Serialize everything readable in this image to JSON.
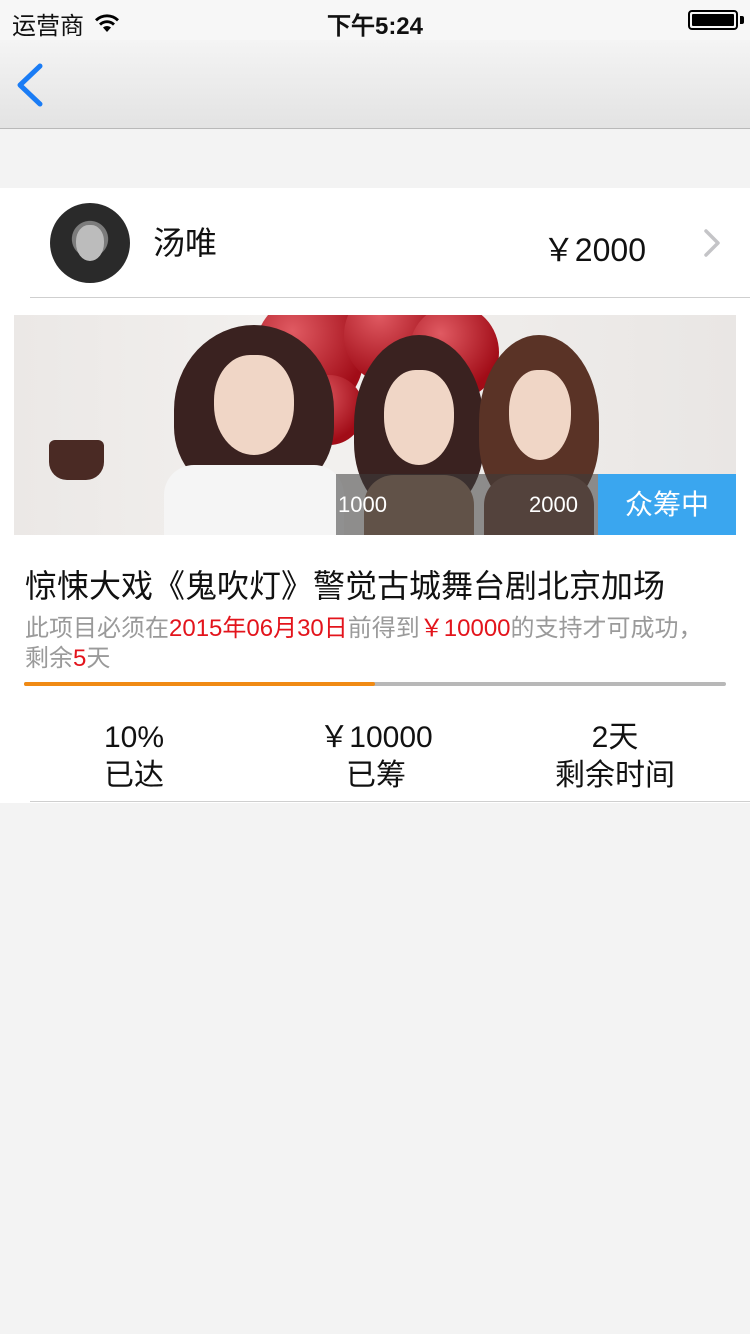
{
  "status_bar": {
    "carrier": "运营商",
    "time": "下午5:24",
    "wifi_icon": "wifi-icon",
    "battery_icon": "battery-icon"
  },
  "nav": {
    "back_icon": "chevron-left-icon",
    "accent_color": "#1a7cf5"
  },
  "backer": {
    "name": "汤唯",
    "amount": "￥2000",
    "chevron_icon": "chevron-right-icon"
  },
  "banner": {
    "tier_low": "1000",
    "tier_high": "2000",
    "status": "众筹中",
    "status_color": "#3aa6ef"
  },
  "project": {
    "title": "惊悚大戏《鬼吹灯》警觉古城舞台剧北京加场",
    "condition_prefix": "此项目必须在",
    "deadline": "2015年06月30日",
    "condition_mid": "前得到",
    "goal": "￥10000",
    "condition_suffix": "的支持才可成功，剩余",
    "remaining_days": "5",
    "condition_end": "天",
    "progress": 0.5,
    "progress_color": "#f08a14"
  },
  "stats": [
    {
      "value": "10%",
      "label": "已达"
    },
    {
      "value": "￥10000",
      "label": "已筹"
    },
    {
      "value": "2天",
      "label": "剩余时间"
    }
  ]
}
